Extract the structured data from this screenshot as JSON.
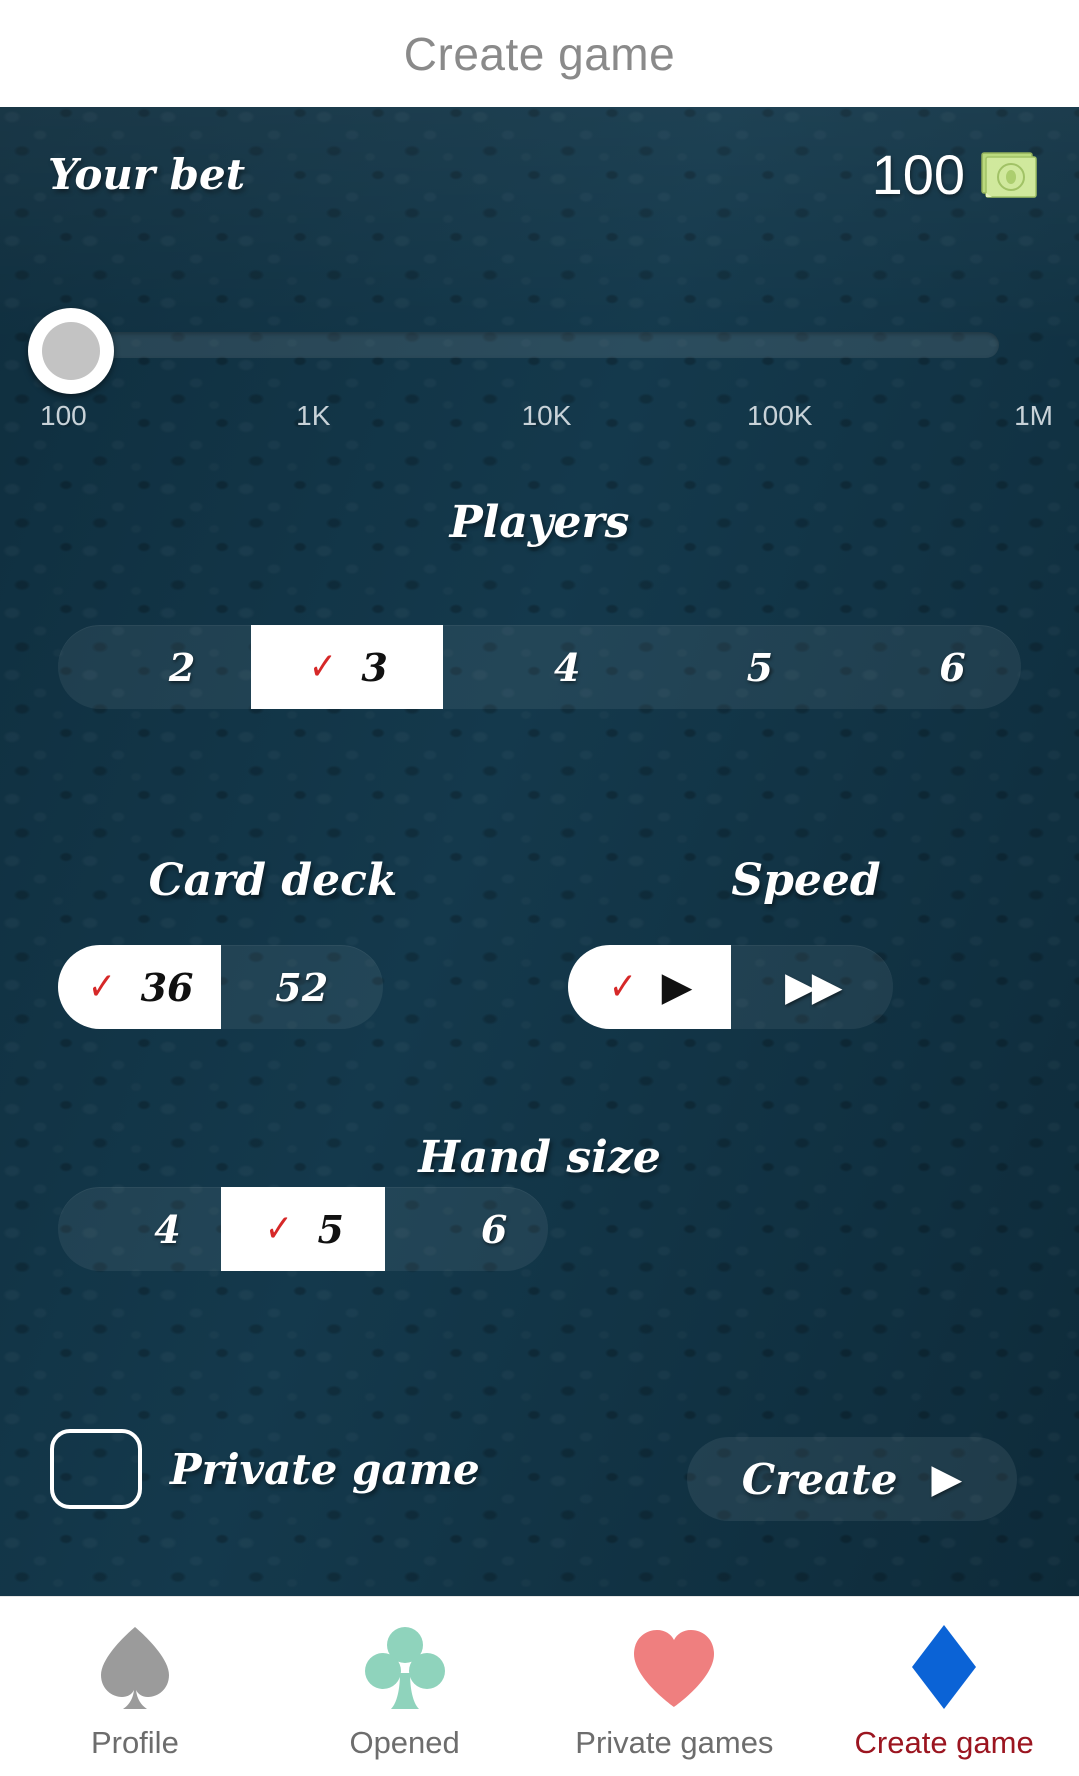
{
  "header": {
    "title": "Create game"
  },
  "bet": {
    "label": "Your bet",
    "value": "100",
    "money_icon": "money-banknote-icon",
    "ticks": [
      "100",
      "1K",
      "10K",
      "100K",
      "1M"
    ]
  },
  "players": {
    "title": "Players",
    "options": [
      {
        "label": "2",
        "selected": false
      },
      {
        "label": "3",
        "selected": true
      },
      {
        "label": "4",
        "selected": false
      },
      {
        "label": "5",
        "selected": false
      },
      {
        "label": "6",
        "selected": false
      }
    ]
  },
  "card_deck": {
    "title": "Card deck",
    "options": [
      {
        "label": "36",
        "selected": true
      },
      {
        "label": "52",
        "selected": false
      }
    ]
  },
  "speed": {
    "title": "Speed",
    "options": [
      {
        "label": "▶",
        "icon": "play-icon",
        "selected": true
      },
      {
        "label": "▶▶",
        "icon": "fast-forward-icon",
        "selected": false
      }
    ]
  },
  "hand_size": {
    "title": "Hand size",
    "options": [
      {
        "label": "4",
        "selected": false
      },
      {
        "label": "5",
        "selected": true
      },
      {
        "label": "6",
        "selected": false
      }
    ]
  },
  "private_game": {
    "label": "Private game",
    "checked": false
  },
  "create_button": {
    "label": "Create",
    "arrow": "▶"
  },
  "bottom_nav": {
    "items": [
      {
        "label": "Profile",
        "icon": "spade-icon",
        "color": "#9b9b9b",
        "active": false
      },
      {
        "label": "Opened",
        "icon": "club-icon",
        "color": "#8fd3bc",
        "active": false
      },
      {
        "label": "Private games",
        "icon": "heart-icon",
        "color": "#ef7f7f",
        "active": false
      },
      {
        "label": "Create game",
        "icon": "diamond-icon",
        "color": "#0b63d6",
        "active": true
      }
    ]
  },
  "colors": {
    "board": "#113446",
    "check_red": "#d62828",
    "title_gray": "#8a8a8a",
    "active_nav": "#9b1520"
  },
  "check_glyph": "✓"
}
